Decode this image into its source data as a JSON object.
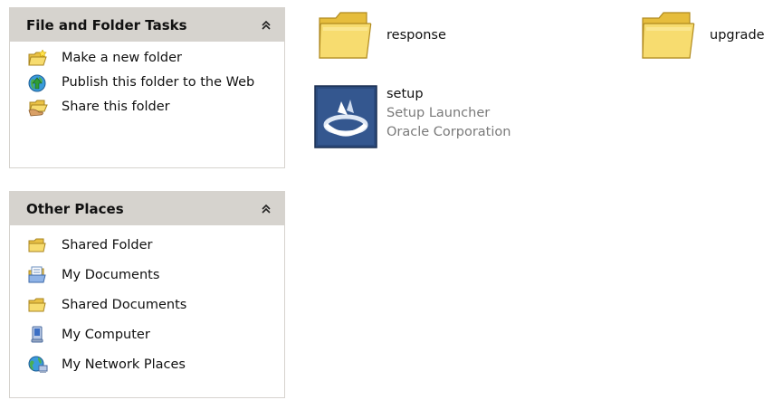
{
  "file_tasks": {
    "title": "File and Folder Tasks",
    "items": [
      {
        "label": "Make a new folder",
        "icon": "new-folder-icon"
      },
      {
        "label": "Publish this folder to the Web",
        "icon": "publish-web-icon"
      },
      {
        "label": "Share this folder",
        "icon": "share-folder-icon"
      }
    ]
  },
  "other_places": {
    "title": "Other Places",
    "items": [
      {
        "label": "Shared Folder",
        "icon": "folder-icon"
      },
      {
        "label": "My Documents",
        "icon": "my-documents-icon"
      },
      {
        "label": "Shared Documents",
        "icon": "folder-icon"
      },
      {
        "label": "My Computer",
        "icon": "my-computer-icon"
      },
      {
        "label": "My Network Places",
        "icon": "network-places-icon"
      }
    ]
  },
  "files": {
    "items": [
      {
        "name": "response",
        "icon": "folder-icon"
      },
      {
        "name": "upgrade",
        "icon": "folder-icon"
      },
      {
        "name": "setup",
        "description": "Setup Launcher",
        "company": "Oracle Corporation",
        "icon": "setup-launcher-icon"
      }
    ]
  },
  "colors": {
    "pane_header": "#d6d3ce",
    "pane_border": "#d6d3ce",
    "folder_yellow": "#f7dc6f",
    "setup_blue": "#2b4a7d"
  }
}
